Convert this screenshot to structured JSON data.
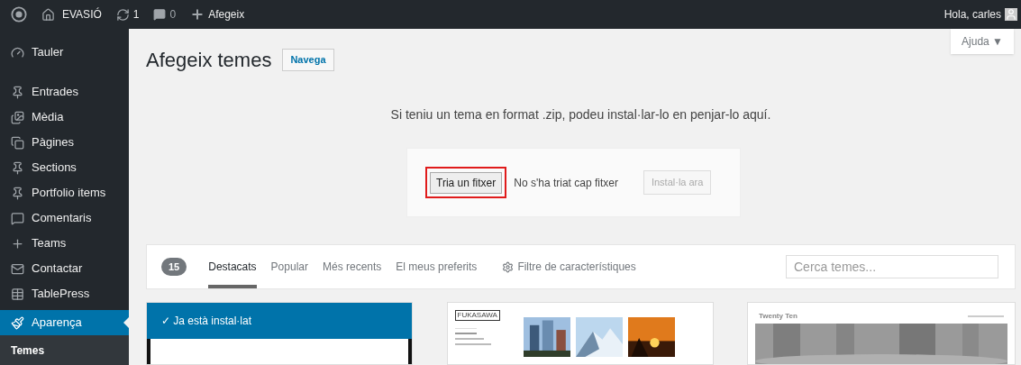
{
  "admin_bar": {
    "site": "EVASIÓ",
    "updates": "1",
    "comments": "0",
    "new": "Afegeix",
    "greeting": "Hola, carles"
  },
  "sidebar": {
    "items": [
      {
        "label": "Tauler",
        "kind": "gauge",
        "selected": false
      },
      {
        "label": "Entrades",
        "kind": "pin",
        "selected": false
      },
      {
        "label": "Mèdia",
        "kind": "media",
        "selected": false
      },
      {
        "label": "Pàgines",
        "kind": "pages",
        "selected": false
      },
      {
        "label": "Sections",
        "kind": "pin",
        "selected": false
      },
      {
        "label": "Portfolio items",
        "kind": "pin",
        "selected": false
      },
      {
        "label": "Comentaris",
        "kind": "comment",
        "selected": false
      },
      {
        "label": "Teams",
        "kind": "plus",
        "selected": false
      },
      {
        "label": "Contactar",
        "kind": "mail",
        "selected": false
      },
      {
        "label": "TablePress",
        "kind": "table",
        "selected": false
      },
      {
        "label": "Aparença",
        "kind": "brush",
        "selected": true,
        "children": [
          {
            "label": "Temes",
            "selected": true
          }
        ]
      }
    ]
  },
  "help_tab": "Ajuda ▼",
  "page": {
    "title": "Afegeix temes",
    "browse_button": "Navega"
  },
  "upload": {
    "message": "Si teniu un tema en format .zip, podeu instal·lar-lo en penjar-lo aquí.",
    "choose_button": "Tria un fitxer",
    "choose_highlighted": true,
    "file_status": "No s'ha triat cap fitxer",
    "install_button": "Instal·la ara",
    "install_disabled": true
  },
  "filter_bar": {
    "count": "15",
    "tabs": [
      {
        "label": "Destacats",
        "selected": true
      },
      {
        "label": "Popular",
        "selected": false
      },
      {
        "label": "Més recents",
        "selected": false
      },
      {
        "label": "El meus preferits",
        "selected": false
      }
    ],
    "feature_filter": "Filtre de característiques",
    "search": {
      "placeholder": "Cerca temes..."
    }
  },
  "themes": [
    {
      "kind": "installed",
      "notice": "✓ Ja està instal·lat"
    },
    {
      "kind": "gallery",
      "logo": "FUKASAWA"
    },
    {
      "kind": "classic",
      "header": "Twenty Ten"
    }
  ]
}
